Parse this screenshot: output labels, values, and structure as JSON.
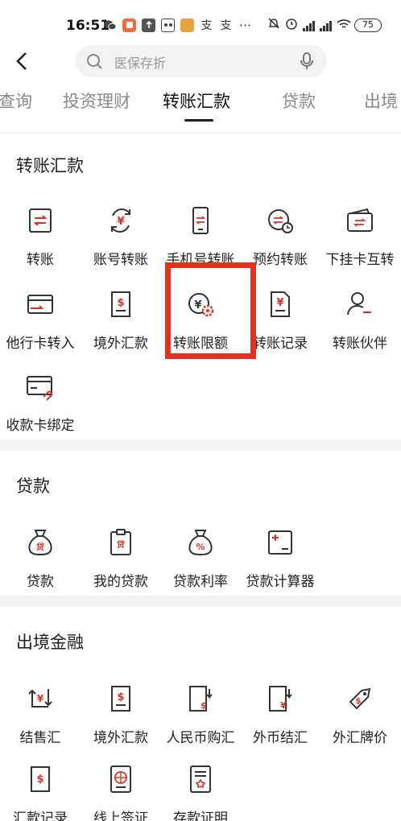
{
  "status_bar": {
    "time": "16:51",
    "battery": "75",
    "icons": [
      "wechat-icon",
      "app-icon",
      "upload-icon",
      "vr-icon",
      "game-icon",
      "alipay-icon",
      "alipay-icon",
      "more-icon",
      "mute-icon",
      "alarm-icon",
      "hd-signal-icon",
      "hd-signal-icon",
      "wifi-icon",
      "battery-icon"
    ]
  },
  "header": {
    "search_placeholder": "医保存折",
    "tabs": [
      "查询",
      "投资理财",
      "转账汇款",
      "贷款",
      "出境"
    ],
    "active_tab": "转账汇款"
  },
  "colors": {
    "accent": "#e8301f",
    "icon": "#333333",
    "icon_red": "#d8322a",
    "highlight": "#e8301f"
  },
  "sections": {
    "transfer": {
      "title": "转账汇款",
      "items": [
        {
          "label": "转账",
          "icon": "transfer-icon"
        },
        {
          "label": "账号转账",
          "icon": "yuan-cycle-icon"
        },
        {
          "label": "手机号转账",
          "icon": "phone-transfer-icon"
        },
        {
          "label": "预约转账",
          "icon": "scheduled-transfer-icon"
        },
        {
          "label": "下挂卡互转",
          "icon": "wallet-transfer-icon"
        },
        {
          "label": "他行卡转入",
          "icon": "card-in-icon"
        },
        {
          "label": "境外汇款",
          "icon": "dollar-doc-icon"
        },
        {
          "label": "转账限额",
          "icon": "yuan-gear-icon"
        },
        {
          "label": "转账记录",
          "icon": "yuan-doc-icon"
        },
        {
          "label": "转账伙伴",
          "icon": "person-icon"
        },
        {
          "label": "收款卡绑定",
          "icon": "card-link-icon"
        }
      ]
    },
    "loan": {
      "title": "贷款",
      "items": [
        {
          "label": "贷款",
          "icon": "loan-bag-icon"
        },
        {
          "label": "我的贷款",
          "icon": "loan-clipboard-icon"
        },
        {
          "label": "贷款利率",
          "icon": "percent-bag-icon"
        },
        {
          "label": "贷款计算器",
          "icon": "calculator-icon"
        }
      ]
    },
    "overseas": {
      "title": "出境金融",
      "items": [
        {
          "label": "结售汇",
          "icon": "exchange-icon"
        },
        {
          "label": "境外汇款",
          "icon": "dollar-doc-icon"
        },
        {
          "label": "人民币购汇",
          "icon": "buy-fx-icon"
        },
        {
          "label": "外币结汇",
          "icon": "sell-fx-icon"
        },
        {
          "label": "外汇牌价",
          "icon": "price-tag-icon"
        },
        {
          "label": "汇款记录",
          "icon": "remit-record-icon"
        },
        {
          "label": "线上签证",
          "icon": "visa-icon"
        },
        {
          "label": "存款证明",
          "icon": "deposit-cert-icon"
        }
      ]
    }
  },
  "svgs": {
    "s_transfer": "<rect x='5' y='4' width='26' height='28' rx='2' fill='none' stroke='#333' stroke-width='2'/><path d='M11 15h13l-3-3M25 21H12l3 3' fill='none' stroke='#d8322a' stroke-width='2'/>",
    "s_yuan_cycle": "<path d='M8 12a12 12 0 0 1 21-3M28 24a12 12 0 0 1-21 3' fill='none' stroke='#333' stroke-width='2'/><path d='M29 4v6h-6M7 32v-6h6' fill='none' stroke='#333' stroke-width='2'/><text x='18' y='23' font-size='13' text-anchor='middle' fill='#d8322a' font-family='DejaVu Sans' font-weight='bold'>¥</text>",
    "s_phone": "<rect x='9' y='2' width='18' height='32' rx='2' fill='none' stroke='#333' stroke-width='2'/><path d='M13 15h9l-2-2M23 20h-9l2 2' fill='none' stroke='#d8322a' stroke-width='1.8'/><line x1='15' y1='29' x2='21' y2='29' stroke='#333' stroke-width='2'/>",
    "s_scheduled": "<circle cx='16' cy='17' r='12' fill='none' stroke='#333' stroke-width='2'/><path d='M10 15h10l-2-2M21 20H11l2 2' fill='none' stroke='#d8322a' stroke-width='1.8'/><circle cx='27' cy='27' r='6' fill='#fff' stroke='#333' stroke-width='2'/><path d='M27 24v3h3' fill='none' stroke='#333' stroke-width='1.6'/>",
    "s_wallet": "<rect x='3' y='9' width='30' height='22' rx='3' fill='none' stroke='#333' stroke-width='2'/><path d='M7 9l20-5 2 5' fill='none' stroke='#333' stroke-width='2'/><path d='M12 18h11l-2-2M23 23H12l2 2' fill='none' stroke='#d8322a' stroke-width='1.8'/>",
    "s_card_in": "<rect x='3' y='7' width='30' height='22' rx='2' fill='none' stroke='#333' stroke-width='2'/><line x1='3' y1='13' x2='33' y2='13' stroke='#333' stroke-width='2'/><path d='M6 23h14l-3-3' fill='none' stroke='#d8322a' stroke-width='2'/>",
    "s_dollar_doc": "<path d='M7 3h22v30H7z' fill='none' stroke='#333' stroke-width='2'/><text x='18' y='20' font-size='13' text-anchor='middle' fill='#d8322a' font-family='DejaVu Sans' font-weight='bold'>$</text><line x1='12' y1='26' x2='24' y2='26' stroke='#333' stroke-width='2'/>",
    "s_yuan_gear": "<circle cx='16' cy='17' r='12' fill='none' stroke='#333' stroke-width='2'/><text x='15' y='23' font-size='13' text-anchor='middle' fill='#333' font-family='DejaVu Sans' font-weight='bold'>¥</text><circle cx='27' cy='26' r='6' fill='#fff' stroke='#d8322a' stroke-width='2.5' stroke-dasharray='3 1.5'/><circle cx='27' cy='26' r='2' fill='#d8322a'/>",
    "s_yuan_doc": "<path d='M7 3h16l6 6v24H7z' fill='none' stroke='#333' stroke-width='2'/><text x='18' y='20' font-size='13' text-anchor='middle' fill='#d8322a' font-family='DejaVu Sans' font-weight='bold'>¥</text><line x1='12' y1='26' x2='24' y2='26' stroke='#333' stroke-width='2'/>",
    "s_person": "<circle cx='15' cy='11' r='7' fill='none' stroke='#333' stroke-width='2'/><path d='M3 31c1-8 6-11 12-11 3 0 5 1 7 2' fill='none' stroke='#333' stroke-width='2'/><line x1='22' y1='28' x2='32' y2='28' stroke='#d8322a' stroke-width='2.2'/>",
    "s_card_link": "<rect x='2' y='6' width='30' height='22' rx='2' fill='none' stroke='#333' stroke-width='2'/><line x1='2' y1='12' x2='32' y2='12' stroke='#333' stroke-width='2'/><line x1='6' y1='20' x2='14' y2='20' stroke='#333' stroke-width='2'/><path d='M22 31l6-6a3 3 0 0 1 4 4l-6 6M26 27l-4 4' fill='none' stroke='#d8322a' stroke-width='2'/>",
    "s_loan_bag": "<path d='M12 3h12l-3 7h-6z' fill='none' stroke='#333' stroke-width='2'/><path d='M15 10c-9 4-12 12-10 18 2 4 6 5 13 5s11-1 13-5c2-6-1-14-10-18' fill='none' stroke='#333' stroke-width='2'/><text x='18' y='27' font-size='10' text-anchor='middle' fill='#d8322a' font-family='DejaVu Sans' font-weight='bold'>贷</text>",
    "s_loan_clip": "<rect x='6' y='5' width='24' height='28' rx='2' fill='none' stroke='#333' stroke-width='2'/><rect x='13' y='2' width='10' height='6' rx='1' fill='#fff' stroke='#333' stroke-width='2'/><text x='18' y='24' font-size='10' text-anchor='middle' fill='#d8322a' font-family='DejaVu Sans' font-weight='bold'>贷</text>",
    "s_percent_bag": "<path d='M12 3h12l-3 7h-6z' fill='none' stroke='#333' stroke-width='2'/><path d='M15 10c-9 4-12 12-10 18 2 4 6 5 13 5s11-1 13-5c2-6-1-14-10-18' fill='none' stroke='#333' stroke-width='2'/><text x='18' y='27' font-size='11' text-anchor='middle' fill='#d8322a' font-family='DejaVu Sans' font-weight='bold'>%</text>",
    "s_calc": "<rect x='4' y='4' width='28' height='28' rx='2' fill='none' stroke='#333' stroke-width='2'/><path d='M8 12h8M12 8v8' stroke='#d8322a' stroke-width='2'/><path d='M20 26h8' stroke='#333' stroke-width='2'/>",
    "s_exchange": "<path d='M8 8v20h20' fill='none' stroke='#333' stroke-width='2'/><path d='M28 6v20' fill='none' stroke='#333' stroke-width='2'/><path d='M4 12l4-4 4 4M24 22l4 4 4-4' fill='none' stroke='#333' stroke-width='2'/><text x='18' y='22' font-size='12' text-anchor='middle' fill='#d8322a' font-family='DejaVu Sans' font-weight='bold'>¥</text>",
    "s_buy_fx": "<path d='M5 3h20v30H5z' fill='none' stroke='#333' stroke-width='2'/><path d='M29 6v10l-3-3M29 16l3-3' fill='none' stroke='#333' stroke-width='2'/><text x='22' y='30' font-size='11' text-anchor='middle' fill='#d8322a' font-family='DejaVu Sans' font-weight='bold'>$</text>",
    "s_sell_fx": "<path d='M5 3h20v30H5z' fill='none' stroke='#333' stroke-width='2'/><path d='M29 6v10l-3-3M29 16l3-3' fill='none' stroke='#333' stroke-width='2'/><text x='22' y='30' font-size='11' text-anchor='middle' fill='#d8322a' font-family='DejaVu Sans' font-weight='bold'>¥</text>",
    "s_tag": "<path d='M6 22L20 8l10-2-2 10-14 14z' fill='none' stroke='#333' stroke-width='2'/><circle cx='24' cy='12' r='2' fill='#333'/><text x='16' y='24' font-size='10' text-anchor='middle' fill='#d8322a' font-family='DejaVu Sans' font-weight='bold'>$</text>",
    "s_remit": "<path d='M7 3h22v30H7z' fill='none' stroke='#333' stroke-width='2'/><text x='18' y='22' font-size='13' text-anchor='middle' fill='#d8322a' font-family='DejaVu Sans' font-weight='bold'>$</text>",
    "s_visa": "<rect x='6' y='2' width='24' height='32' rx='2' fill='none' stroke='#333' stroke-width='2'/><circle cx='18' cy='16' r='7' fill='none' stroke='#d8322a' stroke-width='1.8'/><path d='M11 16h14M18 9v14' stroke='#d8322a' stroke-width='1.4'/><line x1='12' y1='28' x2='24' y2='28' stroke='#333' stroke-width='2'/>",
    "s_deposit": "<rect x='6' y='2' width='24' height='32' rx='2' fill='none' stroke='#333' stroke-width='2'/><line x1='11' y1='9' x2='25' y2='9' stroke='#333' stroke-width='2'/><line x1='11' y1='14' x2='25' y2='14' stroke='#333' stroke-width='2'/><path d='M18 19l2 3 3 1-2 2 0 3-3-1-3 1 0-3-2-2 3-1z' fill='none' stroke='#d8322a' stroke-width='1.6'/>"
  }
}
